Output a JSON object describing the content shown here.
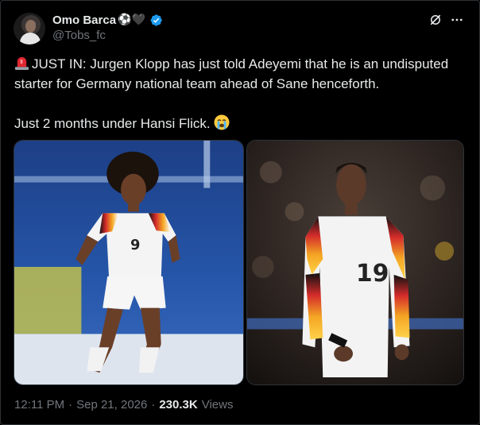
{
  "author": {
    "display_name": "Omo Barca",
    "name_emojis": "⚽🖤",
    "handle": "@Tobs_fc",
    "verified": true
  },
  "tweet": {
    "line1": "JUST IN: Jurgen Klopp has just told Adeyemi that he is an undisputed starter for Germany national team ahead of Sane henceforth.",
    "line2": "Just 2 months under Hansi Flick.",
    "lead_emoji": "siren-emoji",
    "trail_emoji": "loudly-crying-face-emoji"
  },
  "media": [
    {
      "alt": "player-photo-left",
      "shirt_number": "9"
    },
    {
      "alt": "player-photo-right",
      "shirt_number": "19"
    }
  ],
  "meta": {
    "time": "12:11 PM",
    "separator": "·",
    "date": "Sep 21, 2026",
    "views_count": "230.3K",
    "views_label": "Views"
  },
  "colors": {
    "background": "#000000",
    "text": "#e7e9ea",
    "muted": "#71767b",
    "verified": "#1d9bf0"
  },
  "icons": [
    "grok-icon",
    "more-icon",
    "verified-badge-icon"
  ]
}
